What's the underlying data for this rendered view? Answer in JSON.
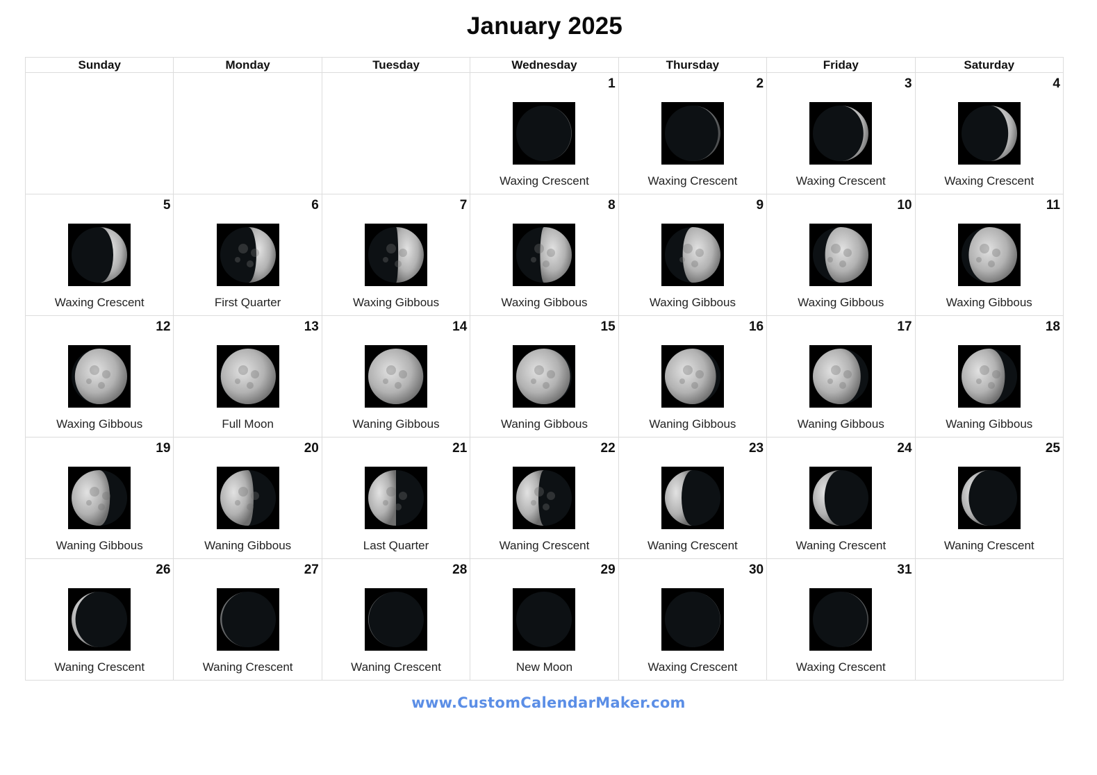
{
  "title": "January 2025",
  "weekdays": [
    "Sunday",
    "Monday",
    "Tuesday",
    "Wednesday",
    "Thursday",
    "Friday",
    "Saturday"
  ],
  "moon_colors": {
    "background": "#000000",
    "lit": "#bdbdbd",
    "dark": "#0d1114"
  },
  "weeks": [
    [
      null,
      null,
      null,
      {
        "day": "1",
        "phase": "Waxing Crescent",
        "illum_fraction": 0.01,
        "waxing": true
      },
      {
        "day": "2",
        "phase": "Waxing Crescent",
        "illum_fraction": 0.04,
        "waxing": true
      },
      {
        "day": "3",
        "phase": "Waxing Crescent",
        "illum_fraction": 0.09,
        "waxing": true
      },
      {
        "day": "4",
        "phase": "Waxing Crescent",
        "illum_fraction": 0.16,
        "waxing": true
      }
    ],
    [
      {
        "day": "5",
        "phase": "Waxing Crescent",
        "illum_fraction": 0.25,
        "waxing": true
      },
      {
        "day": "6",
        "phase": "First Quarter",
        "illum_fraction": 0.35,
        "waxing": true
      },
      {
        "day": "7",
        "phase": "Waxing Gibbous",
        "illum_fraction": 0.46,
        "waxing": true
      },
      {
        "day": "8",
        "phase": "Waxing Gibbous",
        "illum_fraction": 0.57,
        "waxing": true
      },
      {
        "day": "9",
        "phase": "Waxing Gibbous",
        "illum_fraction": 0.68,
        "waxing": true
      },
      {
        "day": "10",
        "phase": "Waxing Gibbous",
        "illum_fraction": 0.78,
        "waxing": true
      },
      {
        "day": "11",
        "phase": "Waxing Gibbous",
        "illum_fraction": 0.87,
        "waxing": true
      }
    ],
    [
      {
        "day": "12",
        "phase": "Waxing Gibbous",
        "illum_fraction": 0.94,
        "waxing": true
      },
      {
        "day": "13",
        "phase": "Full Moon",
        "illum_fraction": 0.99,
        "waxing": true
      },
      {
        "day": "14",
        "phase": "Waning Gibbous",
        "illum_fraction": 0.99,
        "waxing": false
      },
      {
        "day": "15",
        "phase": "Waning Gibbous",
        "illum_fraction": 0.97,
        "waxing": false
      },
      {
        "day": "16",
        "phase": "Waning Gibbous",
        "illum_fraction": 0.92,
        "waxing": false
      },
      {
        "day": "17",
        "phase": "Waning Gibbous",
        "illum_fraction": 0.86,
        "waxing": false
      },
      {
        "day": "18",
        "phase": "Waning Gibbous",
        "illum_fraction": 0.78,
        "waxing": false
      }
    ],
    [
      {
        "day": "19",
        "phase": "Waning Gibbous",
        "illum_fraction": 0.69,
        "waxing": false
      },
      {
        "day": "20",
        "phase": "Waning Gibbous",
        "illum_fraction": 0.6,
        "waxing": false
      },
      {
        "day": "21",
        "phase": "Last Quarter",
        "illum_fraction": 0.5,
        "waxing": false
      },
      {
        "day": "22",
        "phase": "Waning Crescent",
        "illum_fraction": 0.4,
        "waxing": false
      },
      {
        "day": "23",
        "phase": "Waning Crescent",
        "illum_fraction": 0.3,
        "waxing": false
      },
      {
        "day": "24",
        "phase": "Waning Crescent",
        "illum_fraction": 0.21,
        "waxing": false
      },
      {
        "day": "25",
        "phase": "Waning Crescent",
        "illum_fraction": 0.13,
        "waxing": false
      }
    ],
    [
      {
        "day": "26",
        "phase": "Waning Crescent",
        "illum_fraction": 0.07,
        "waxing": false
      },
      {
        "day": "27",
        "phase": "Waning Crescent",
        "illum_fraction": 0.03,
        "waxing": false
      },
      {
        "day": "28",
        "phase": "Waning Crescent",
        "illum_fraction": 0.01,
        "waxing": false
      },
      {
        "day": "29",
        "phase": "New Moon",
        "illum_fraction": 0.0,
        "waxing": false
      },
      {
        "day": "30",
        "phase": "Waxing Crescent",
        "illum_fraction": 0.005,
        "waxing": true
      },
      {
        "day": "31",
        "phase": "Waxing Crescent",
        "illum_fraction": 0.02,
        "waxing": true
      },
      null
    ]
  ],
  "footer": {
    "link_text": "www.CustomCalendarMaker.com"
  }
}
